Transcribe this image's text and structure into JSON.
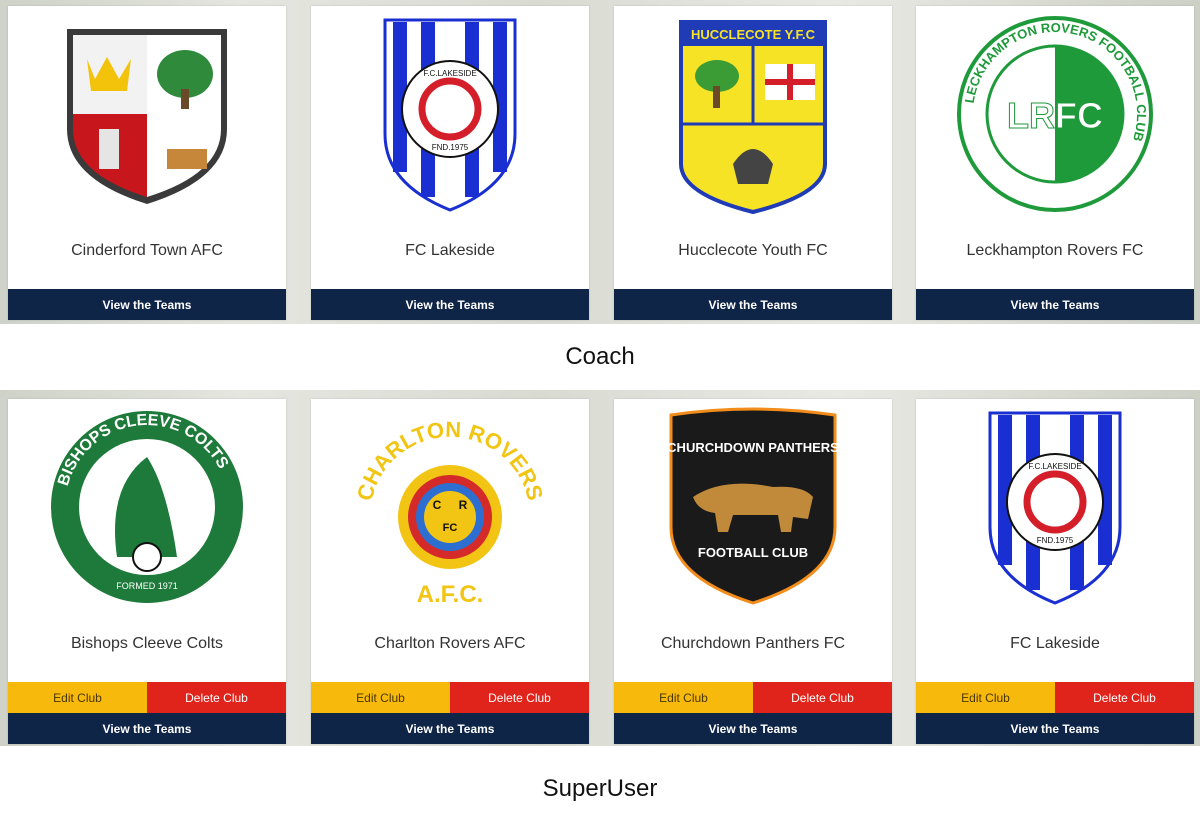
{
  "coach_section": {
    "role_label": "Coach",
    "clubs": [
      {
        "name": "Cinderford Town AFC",
        "crest": "cinderford-crest",
        "view_label": "View the Teams"
      },
      {
        "name": "FC Lakeside",
        "crest": "lakeside-crest",
        "crest_text_top": "F.C.LAKESIDE",
        "crest_text_bottom": "FND.1975",
        "view_label": "View the Teams"
      },
      {
        "name": "Hucclecote Youth FC",
        "crest": "hucclecote-crest",
        "crest_text": "HUCCLECOTE Y.F.C",
        "view_label": "View the Teams"
      },
      {
        "name": "Leckhampton Rovers FC",
        "crest": "leckhampton-crest",
        "crest_text_ring": "LECKHAMPTON ROVERS FOOTBALL CLUB",
        "crest_text_center": "LRFC",
        "view_label": "View the Teams"
      }
    ]
  },
  "superuser_section": {
    "role_label": "SuperUser",
    "clubs": [
      {
        "name": "Bishops Cleeve Colts",
        "crest": "bishops-cleeve-crest",
        "crest_text_ring": "BISHOPS CLEEVE COLTS",
        "crest_text_bottom": "FORMED 1971",
        "edit_label": "Edit Club",
        "delete_label": "Delete Club",
        "view_label": "View the Teams"
      },
      {
        "name": "Charlton Rovers AFC",
        "crest": "charlton-crest",
        "crest_text_arc": "CHARLTON ROVERS",
        "crest_text_bottom": "A.F.C.",
        "crest_text_c": "C",
        "crest_text_r": "R",
        "crest_text_fc": "FC",
        "edit_label": "Edit Club",
        "delete_label": "Delete Club",
        "view_label": "View the Teams"
      },
      {
        "name": "Churchdown Panthers FC",
        "crest": "churchdown-crest",
        "crest_text_top": "CHURCHDOWN PANTHERS",
        "crest_text_bottom": "FOOTBALL CLUB",
        "edit_label": "Edit Club",
        "delete_label": "Delete Club",
        "view_label": "View the Teams"
      },
      {
        "name": "FC Lakeside",
        "crest": "lakeside-crest",
        "crest_text_top": "F.C.LAKESIDE",
        "crest_text_bottom": "FND.1975",
        "edit_label": "Edit Club",
        "delete_label": "Delete Club",
        "view_label": "View the Teams"
      }
    ]
  },
  "colors": {
    "navy_button": "#0f2548",
    "edit_yellow": "#f7b90b",
    "delete_red": "#e0241b"
  }
}
